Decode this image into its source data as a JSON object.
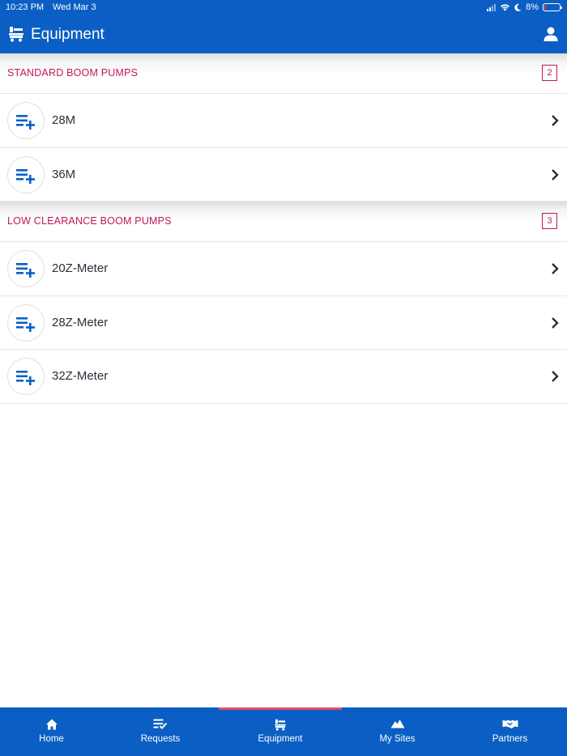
{
  "status_bar": {
    "time": "10:23 PM",
    "date": "Wed Mar 3",
    "battery": "8%"
  },
  "header": {
    "title": "Equipment",
    "title_icon": "equipment-icon",
    "profile_icon": "person-icon"
  },
  "sections": [
    {
      "title": "STANDARD BOOM PUMPS",
      "count": "2",
      "items": [
        {
          "label": "28M"
        },
        {
          "label": "36M"
        }
      ]
    },
    {
      "title": "LOW CLEARANCE BOOM PUMPS",
      "count": "3",
      "items": [
        {
          "label": "20Z-Meter"
        },
        {
          "label": "28Z-Meter"
        },
        {
          "label": "32Z-Meter"
        }
      ]
    }
  ],
  "tabs": [
    {
      "label": "Home",
      "icon": "home-icon"
    },
    {
      "label": "Requests",
      "icon": "requests-icon"
    },
    {
      "label": "Equipment",
      "icon": "equipment-icon",
      "active": true
    },
    {
      "label": "My Sites",
      "icon": "mountain-icon"
    },
    {
      "label": "Partners",
      "icon": "handshake-icon"
    }
  ],
  "colors": {
    "primary": "#0b5fc4",
    "accent": "#c3165f",
    "active_indicator": "#e84a6f"
  }
}
